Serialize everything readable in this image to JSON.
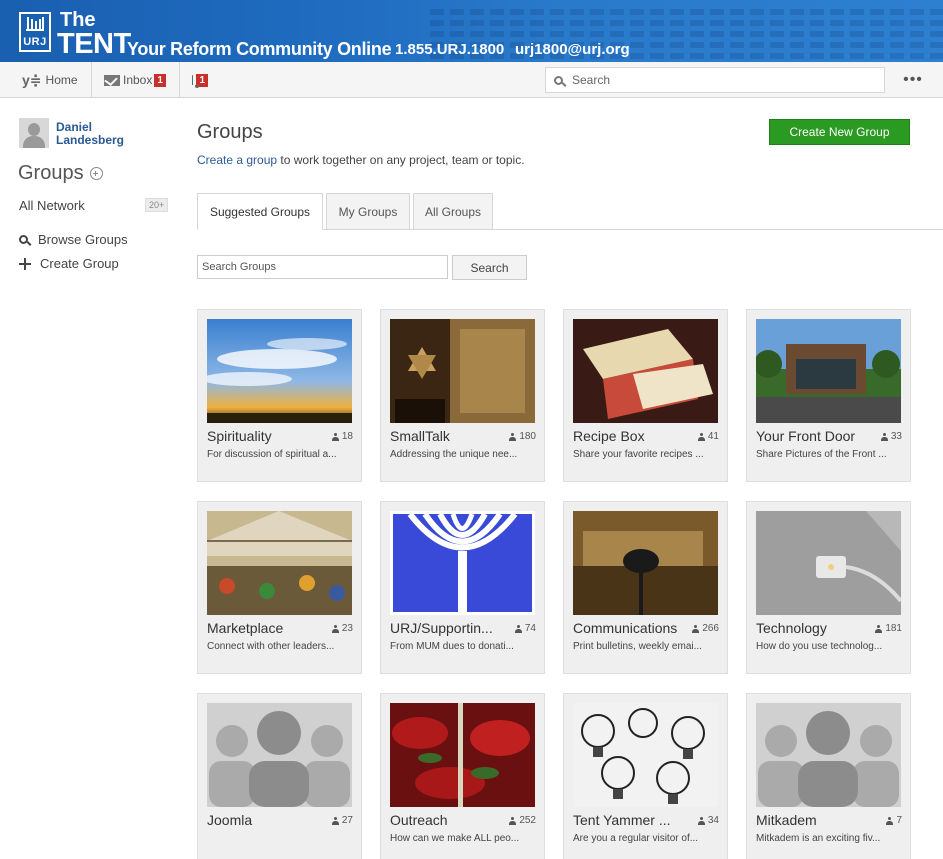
{
  "banner": {
    "brand_the": "The",
    "brand_tent": "TENT",
    "logo_text": "URJ",
    "tagline": "Your Reform Community Online",
    "phone": "1.855.URJ.1800",
    "email": "urj1800@urj.org",
    "color": "#1f6cc0"
  },
  "nav": {
    "home_label": "Home",
    "inbox_label": "Inbox",
    "inbox_count": "1",
    "notifications_count": "1",
    "search_placeholder": "Search",
    "more_label": "•••"
  },
  "sidebar": {
    "user_name": "Daniel Landesberg",
    "title": "Groups",
    "network_label": "All Network",
    "network_count": "20+",
    "browse_label": "Browse Groups",
    "create_label": "Create Group"
  },
  "main": {
    "title": "Groups",
    "subtitle_link": "Create a group",
    "subtitle_rest": " to work together on any project, team or topic.",
    "create_button": "Create New Group",
    "create_button_color": "#2a9a22",
    "tabs": [
      {
        "label": "Suggested Groups",
        "active": true
      },
      {
        "label": "My Groups",
        "active": false
      },
      {
        "label": "All Groups",
        "active": false
      }
    ],
    "search_placeholder": "Search Groups",
    "search_button": "Search"
  },
  "groups": [
    {
      "name": "Spirituality",
      "members": "18",
      "description": "For discussion of spiritual a...",
      "image": "sky-sunset"
    },
    {
      "name": "SmallTalk",
      "members": "180",
      "description": "Addressing the unique nee...",
      "image": "star-of-david-ark"
    },
    {
      "name": "Recipe Box",
      "members": "41",
      "description": "Share your favorite recipes ...",
      "image": "recipe-box"
    },
    {
      "name": "Your Front Door",
      "members": "33",
      "description": "Share Pictures of the Front ...",
      "image": "building"
    },
    {
      "name": "Marketplace",
      "members": "23",
      "description": "Connect with other leaders...",
      "image": "market-hall"
    },
    {
      "name": "URJ/Supportin...",
      "members": "74",
      "description": "From MUM dues to donati...",
      "image": "urj-menorah-logo"
    },
    {
      "name": "Communications",
      "members": "266",
      "description": "Print bulletins, weekly emai...",
      "image": "microphone-hall"
    },
    {
      "name": "Technology",
      "members": "181",
      "description": "How do you use technolog...",
      "image": "laptop-cable"
    },
    {
      "name": "Joomla",
      "members": "27",
      "description": "",
      "image": "people-placeholder"
    },
    {
      "name": "Outreach",
      "members": "252",
      "description": "How can we make ALL peo...",
      "image": "flowers"
    },
    {
      "name": "Tent Yammer ...",
      "members": "34",
      "description": "Are you a regular visitor of...",
      "image": "light-bulbs"
    },
    {
      "name": "Mitkadem",
      "members": "7",
      "description": "Mitkadem is an exciting fiv...",
      "image": "people-placeholder"
    }
  ]
}
